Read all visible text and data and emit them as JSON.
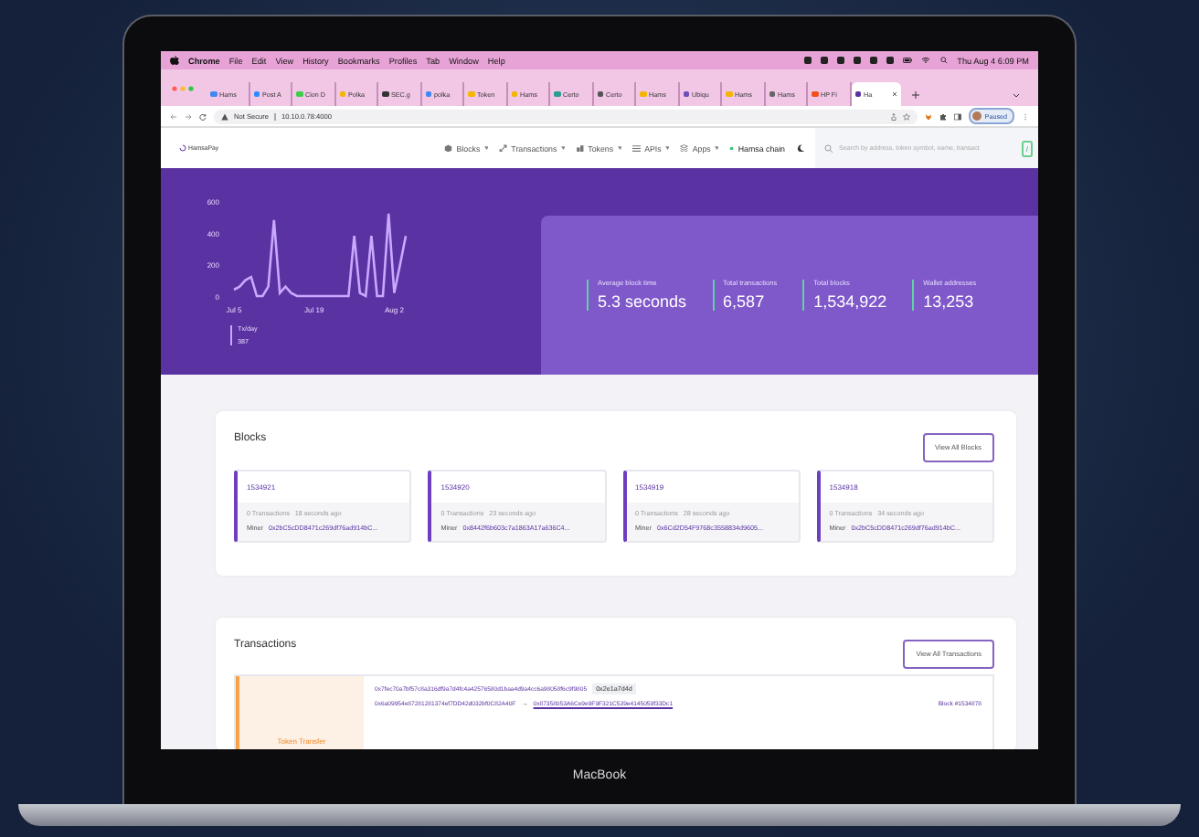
{
  "menu_bar": {
    "app": "Chrome",
    "items": [
      "File",
      "Edit",
      "View",
      "History",
      "Bookmarks",
      "Profiles",
      "Tab",
      "Window",
      "Help"
    ],
    "clock": "Thu Aug 4  6:09 PM"
  },
  "tabs": [
    {
      "title": "Hams",
      "color": "#4285f4",
      "selected": false
    },
    {
      "title": "Post A",
      "color": "#2d8cff",
      "selected": false
    },
    {
      "title": "Cion D",
      "color": "#3ccf4e",
      "selected": false
    },
    {
      "title": "Polka",
      "color": "#f4b400",
      "selected": false
    },
    {
      "title": "SEC.g",
      "color": "#333333",
      "selected": false
    },
    {
      "title": "polka",
      "color": "#4285f4",
      "selected": false
    },
    {
      "title": "Token",
      "color": "#f4b400",
      "selected": false
    },
    {
      "title": "Hams",
      "color": "#f4b400",
      "selected": false
    },
    {
      "title": "Certo",
      "color": "#2a9d8f",
      "selected": false
    },
    {
      "title": "Certo",
      "color": "#555555",
      "selected": false
    },
    {
      "title": "Hams",
      "color": "#f4b400",
      "selected": false
    },
    {
      "title": "Ubiqu",
      "color": "#6b4fbb",
      "selected": false
    },
    {
      "title": "Hams",
      "color": "#f4b400",
      "selected": false
    },
    {
      "title": "Hams",
      "color": "#666666",
      "selected": false
    },
    {
      "title": "HP Fi",
      "color": "#f24e1e",
      "selected": false
    },
    {
      "title": "Ha",
      "color": "#5a32a0",
      "selected": true
    }
  ],
  "address_bar": {
    "security": "Not Secure",
    "url": "10.10.0.78:4000",
    "profile": "Paused"
  },
  "navbar": {
    "logo": "HamsaPay",
    "items": [
      {
        "label": "Blocks",
        "kind": "cube"
      },
      {
        "label": "Transactions",
        "kind": "arrows"
      },
      {
        "label": "Tokens",
        "kind": "token"
      },
      {
        "label": "APIs",
        "kind": "list"
      },
      {
        "label": "Apps",
        "kind": "apps"
      }
    ],
    "network": "Hamsa chain",
    "search": {
      "placeholder": "Search by address, token symbol, name, transact",
      "shortcut": "/"
    }
  },
  "chart": {
    "chart_data": {
      "type": "line",
      "categories": [
        "Jul 5",
        null,
        null,
        null,
        null,
        null,
        null,
        null,
        null,
        null,
        null,
        null,
        null,
        null,
        "Jul 19",
        null,
        null,
        null,
        null,
        null,
        null,
        null,
        null,
        null,
        null,
        null,
        null,
        null,
        "Aug 2",
        null,
        null
      ],
      "series": [
        {
          "name": "Tx/day",
          "color": "#c9a8ff",
          "values": [
            40,
            60,
            100,
            120,
            0,
            0,
            60,
            480,
            20,
            60,
            20,
            0,
            0,
            0,
            0,
            0,
            0,
            0,
            0,
            0,
            0,
            380,
            20,
            0,
            380,
            0,
            0,
            520,
            20,
            200,
            380
          ]
        }
      ],
      "yticks": [
        0,
        200,
        400,
        600
      ],
      "ylim": [
        0,
        600
      ]
    },
    "legend_value": "387"
  },
  "stats": [
    {
      "label": "Average block time",
      "value": "5.3 seconds"
    },
    {
      "label": "Total transactions",
      "value": "6,587"
    },
    {
      "label": "Total blocks",
      "value": "1,534,922"
    },
    {
      "label": "Wallet addresses",
      "value": "13,253"
    }
  ],
  "blocks": {
    "title": "Blocks",
    "button": "View All Blocks",
    "items": [
      {
        "number": "1534921",
        "transactions": "0 Transactions",
        "age": "18 seconds ago",
        "miner_label": "Miner",
        "miner": "0x2bC5cDD8471c269df76ad914bC..."
      },
      {
        "number": "1534920",
        "transactions": "0 Transactions",
        "age": "23 seconds ago",
        "miner_label": "Miner",
        "miner": "0x8442f6b603c7a1863A17a636C4..."
      },
      {
        "number": "1534919",
        "transactions": "0 Transactions",
        "age": "28 seconds ago",
        "miner_label": "Miner",
        "miner": "0x6Cd2D54F9768c3558834d9605..."
      },
      {
        "number": "1534918",
        "transactions": "0 Transactions",
        "age": "34 seconds ago",
        "miner_label": "Miner",
        "miner": "0x2bC5cDD8471c269df76ad914bC..."
      }
    ]
  },
  "transactions": {
    "title": "Transactions",
    "button": "View All Transactions",
    "items": [
      {
        "type": "Token Transfer",
        "hash": "0x7fec70a7bf57c8a316df9a7d4fc4a42576580d1baa4d9a4cc6a98058f6c9f9805",
        "method": "0x2e1a7d4d",
        "from": "0x6a09954e87281281374ef7DD42d032bf0C82A40F",
        "arrow": "→",
        "to": "0x87358053A6Ce9e9F9F321C539e4145059f33Dc1",
        "block": "Block #1534878"
      }
    ]
  },
  "device_label": "MacBook"
}
